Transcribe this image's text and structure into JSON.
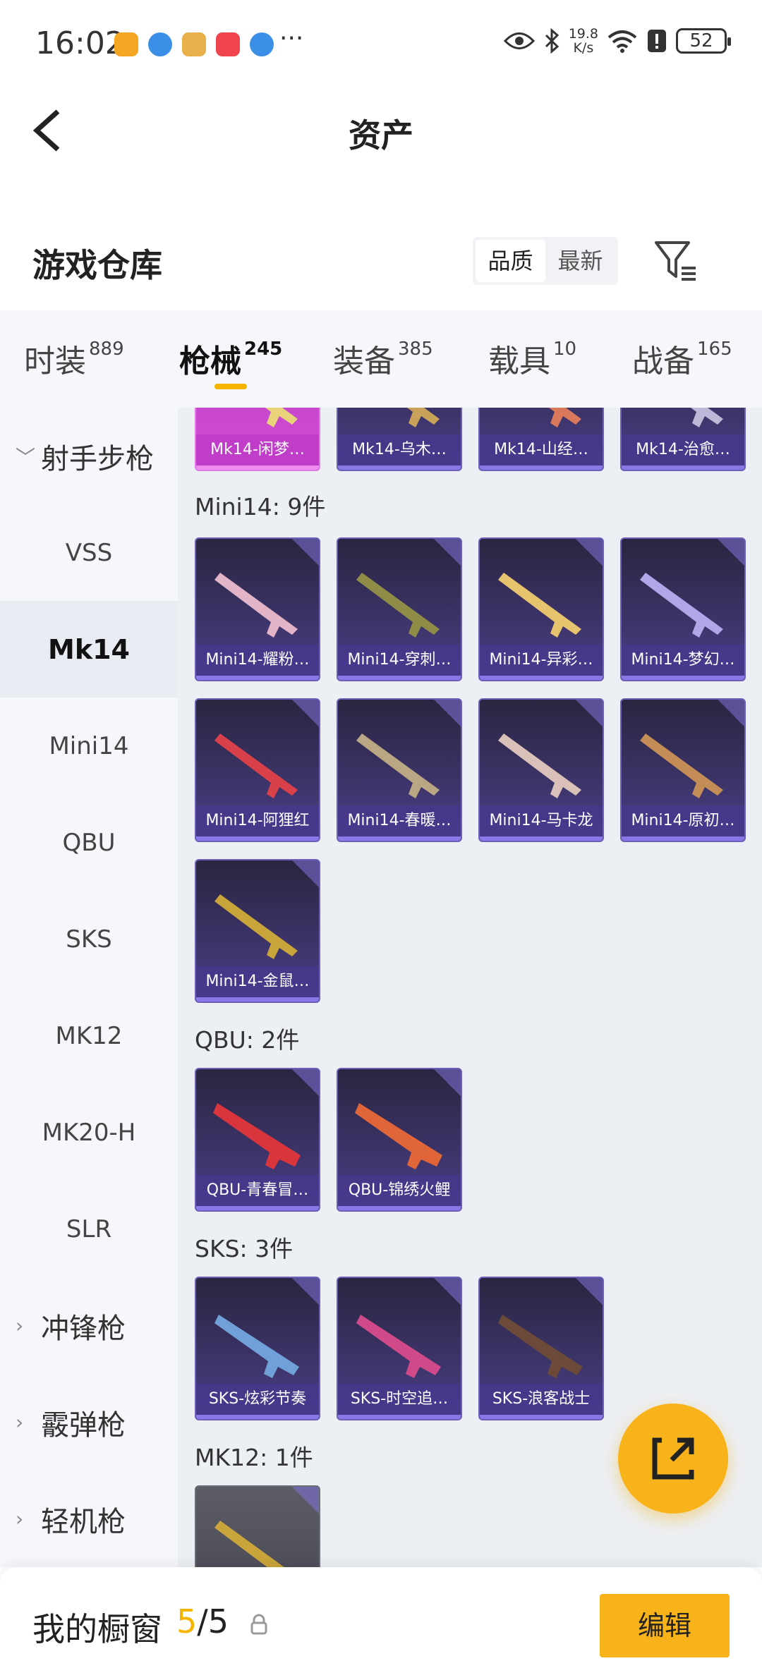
{
  "status_bar": {
    "time": "16:02",
    "overflow": "···",
    "speed_value": "19.8",
    "speed_unit": "K/s",
    "battery": "52"
  },
  "header": {
    "title": "资产"
  },
  "warehouse": {
    "title": "游戏仓库",
    "sort_options": [
      "品质",
      "最新"
    ],
    "sort_active": "品质"
  },
  "tabs": [
    {
      "label": "时装",
      "count": "889"
    },
    {
      "label": "枪械",
      "count": "245"
    },
    {
      "label": "装备",
      "count": "385"
    },
    {
      "label": "载具",
      "count": "10"
    },
    {
      "label": "战备",
      "count": "165"
    }
  ],
  "active_tab": "枪械",
  "sidebar": {
    "items": [
      {
        "label": "射手步枪",
        "type": "group",
        "expanded": true
      },
      {
        "label": "VSS",
        "type": "item"
      },
      {
        "label": "Mk14",
        "type": "item",
        "active": true
      },
      {
        "label": "Mini14",
        "type": "item"
      },
      {
        "label": "QBU",
        "type": "item"
      },
      {
        "label": "SKS",
        "type": "item"
      },
      {
        "label": "MK12",
        "type": "item"
      },
      {
        "label": "MK20-H",
        "type": "item"
      },
      {
        "label": "SLR",
        "type": "item"
      },
      {
        "label": "冲锋枪",
        "type": "group"
      },
      {
        "label": "霰弹枪",
        "type": "group"
      },
      {
        "label": "轻机枪",
        "type": "group"
      }
    ]
  },
  "sections": {
    "mk14": {
      "items": [
        "Mk14-闲梦…",
        "Mk14-乌木…",
        "Mk14-山经…",
        "Mk14-治愈…"
      ]
    },
    "mini14": {
      "title": "Mini14: 9件",
      "items": [
        "Mini14-耀粉…",
        "Mini14-穿刺…",
        "Mini14-异彩…",
        "Mini14-梦幻…",
        "Mini14-阿狸红",
        "Mini14-春暖…",
        "Mini14-马卡龙",
        "Mini14-原初…",
        "Mini14-金鼠…"
      ]
    },
    "qbu": {
      "title": "QBU: 2件",
      "items": [
        "QBU-青春冒…",
        "QBU-锦绣火鲤"
      ]
    },
    "sks": {
      "title": "SKS: 3件",
      "items": [
        "SKS-炫彩节奏",
        "SKS-时空追…",
        "SKS-浪客战士"
      ]
    },
    "mk12": {
      "title": "MK12: 1件"
    }
  },
  "bottom": {
    "title": "我的橱窗",
    "count_current": "5",
    "count_sep": "/",
    "count_total": "5",
    "edit_label": "编辑"
  },
  "colors": {
    "accent": "#f7b319",
    "card_purple": "#3b3366",
    "card_pink": "#d54fd6"
  }
}
